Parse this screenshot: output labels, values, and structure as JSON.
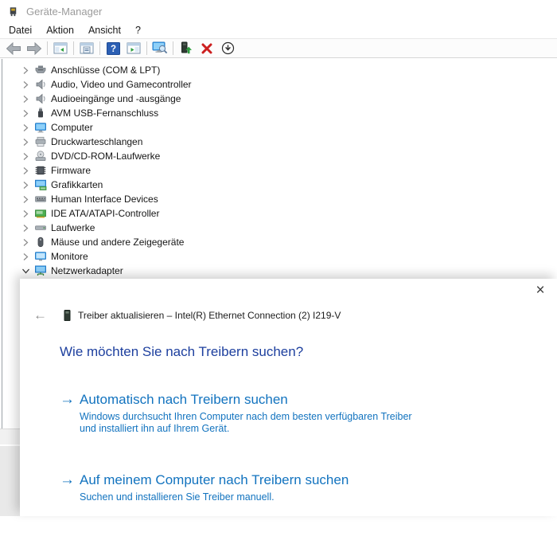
{
  "window": {
    "title": "Geräte-Manager"
  },
  "menu": {
    "items": [
      {
        "id": "datei",
        "label": "Datei"
      },
      {
        "id": "aktion",
        "label": "Aktion"
      },
      {
        "id": "ansicht",
        "label": "Ansicht"
      },
      {
        "id": "hilfe",
        "label": "?"
      }
    ]
  },
  "toolbar": {
    "items": [
      {
        "name": "back-button",
        "icon": "back-arrow-icon"
      },
      {
        "name": "forward-button",
        "icon": "forward-arrow-icon"
      },
      {
        "separator": true
      },
      {
        "name": "show-console-tree-button",
        "icon": "console-tree-icon"
      },
      {
        "separator": true
      },
      {
        "name": "properties-button",
        "icon": "properties-icon"
      },
      {
        "separator": true
      },
      {
        "name": "help-button",
        "icon": "help-icon"
      },
      {
        "name": "action-pane-button",
        "icon": "action-pane-icon"
      },
      {
        "separator": true
      },
      {
        "name": "scan-hardware-changes-button",
        "icon": "scan-hardware-icon"
      },
      {
        "separator": true
      },
      {
        "name": "update-driver-button",
        "icon": "update-driver-icon"
      },
      {
        "name": "uninstall-device-button",
        "icon": "uninstall-icon"
      },
      {
        "name": "disable-device-button",
        "icon": "disable-device-icon"
      }
    ]
  },
  "tree": {
    "items": [
      {
        "label": "Anschlüsse (COM & LPT)",
        "icon": "serial-port-icon",
        "expanded": false
      },
      {
        "label": "Audio, Video und Gamecontroller",
        "icon": "speaker-icon",
        "expanded": false
      },
      {
        "label": "Audioeingänge und -ausgänge",
        "icon": "speaker-icon",
        "expanded": false
      },
      {
        "label": "AVM USB-Fernanschluss",
        "icon": "usb-icon",
        "expanded": false
      },
      {
        "label": "Computer",
        "icon": "computer-icon",
        "expanded": false
      },
      {
        "label": "Druckwarteschlangen",
        "icon": "printer-icon",
        "expanded": false
      },
      {
        "label": "DVD/CD-ROM-Laufwerke",
        "icon": "disc-drive-icon",
        "expanded": false
      },
      {
        "label": "Firmware",
        "icon": "firmware-icon",
        "expanded": false
      },
      {
        "label": "Grafikkarten",
        "icon": "gpu-icon",
        "expanded": false
      },
      {
        "label": "Human Interface Devices",
        "icon": "hid-icon",
        "expanded": false
      },
      {
        "label": "IDE ATA/ATAPI-Controller",
        "icon": "ide-controller-icon",
        "expanded": false
      },
      {
        "label": "Laufwerke",
        "icon": "disk-drive-icon",
        "expanded": false
      },
      {
        "label": "Mäuse und andere Zeigegeräte",
        "icon": "mouse-icon",
        "expanded": false
      },
      {
        "label": "Monitore",
        "icon": "monitor-icon",
        "expanded": false
      },
      {
        "label": "Netzwerkadapter",
        "icon": "network-adapter-icon",
        "expanded": true
      }
    ]
  },
  "dialog": {
    "back_glyph": "←",
    "close_glyph": "×",
    "title": "Treiber aktualisieren – Intel(R) Ethernet Connection (2) I219-V",
    "heading": "Wie möchten Sie nach Treibern suchen?",
    "options": [
      {
        "arrow": "→",
        "label": "Automatisch nach Treibern suchen",
        "description": "Windows durchsucht Ihren Computer nach dem besten verfügbaren Treiber und installiert ihn auf Ihrem Gerät."
      },
      {
        "arrow": "→",
        "label": "Auf meinem Computer nach Treibern suchen",
        "description": "Suchen und installieren Sie Treiber manuell."
      }
    ]
  },
  "colors": {
    "link_blue": "#1273bf",
    "heading_blue": "#1d3f9e",
    "titlebar_text": "#9b9b9b",
    "uninstall_red": "#cc1f1f"
  }
}
